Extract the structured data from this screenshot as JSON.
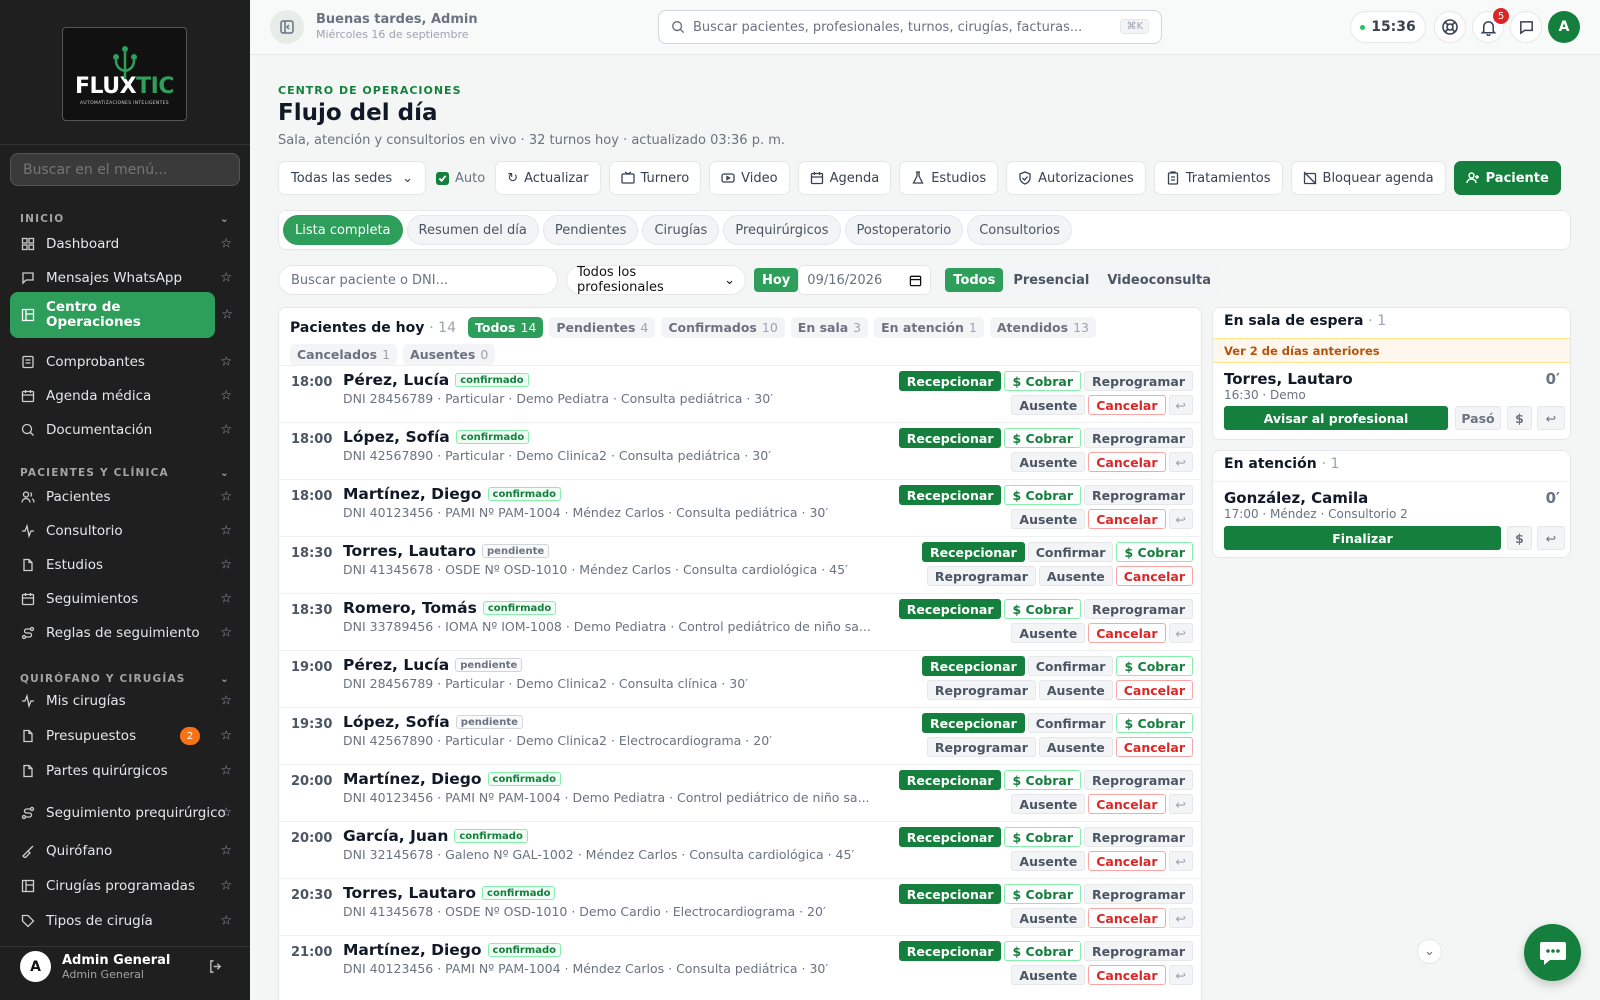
{
  "sidebar": {
    "logo_text_a": "FLUX",
    "logo_text_b": "TIC",
    "logo_sub": "AUTOMATIZACIONES INTELIGENTES",
    "search_placeholder": "Buscar en el menú...",
    "sections": [
      {
        "title": "INICIO"
      },
      {
        "title": "PACIENTES Y CLÍNICA"
      },
      {
        "title": "QUIRÓFANO Y CIRUGÍAS"
      }
    ],
    "items": [
      {
        "label": "Dashboard",
        "icon": "grid-icon"
      },
      {
        "label": "Mensajes WhatsApp",
        "icon": "chat-icon"
      },
      {
        "label": "Centro de Operaciones",
        "icon": "layout-icon",
        "active": true
      },
      {
        "label": "Comprobantes",
        "icon": "receipt-icon"
      },
      {
        "label": "Agenda médica",
        "icon": "calendar-icon"
      },
      {
        "label": "Documentación",
        "icon": "search-doc-icon"
      },
      {
        "label": "Pacientes",
        "icon": "users-icon"
      },
      {
        "label": "Consultorio",
        "icon": "activity-icon"
      },
      {
        "label": "Estudios",
        "icon": "file-icon"
      },
      {
        "label": "Seguimientos",
        "icon": "calendar-icon"
      },
      {
        "label": "Reglas de seguimiento",
        "icon": "route-icon"
      },
      {
        "label": "Mis cirugías",
        "icon": "activity-icon"
      },
      {
        "label": "Presupuestos",
        "icon": "file-icon",
        "badge": "2"
      },
      {
        "label": "Partes quirúrgicos",
        "icon": "file-icon"
      },
      {
        "label": "Seguimiento prequirúrgico",
        "icon": "route-icon"
      },
      {
        "label": "Quirófano",
        "icon": "scalpel-icon"
      },
      {
        "label": "Cirugías programadas",
        "icon": "layout-icon"
      },
      {
        "label": "Tipos de cirugía",
        "icon": "tag-icon"
      }
    ],
    "user": {
      "initial": "A",
      "name": "Admin General",
      "role": "Admin General"
    }
  },
  "topbar": {
    "greeting": "Buenas tardes, Admin",
    "date": "Miércoles 16 de septiembre",
    "search_placeholder": "Buscar pacientes, profesionales, turnos, cirugías, facturas...",
    "shortcut": "⌘K",
    "clock": "15:36",
    "notifications": "5",
    "avatar": "A"
  },
  "header": {
    "eyebrow": "CENTRO DE OPERACIONES",
    "title": "Flujo del día",
    "subtitle": "Sala, atención y consultorios en vivo · 32 turnos hoy · actualizado 03:36 p. m."
  },
  "toolbar": {
    "sede": "Todas las sedes",
    "auto": "Auto",
    "buttons": [
      "Actualizar",
      "Turnero",
      "Video",
      "Agenda",
      "Estudios",
      "Autorizaciones",
      "Tratamientos",
      "Bloquear agenda"
    ],
    "primary": "Paciente"
  },
  "tabs": [
    "Lista completa",
    "Resumen del día",
    "Pendientes",
    "Cirugías",
    "Prequirúrgicos",
    "Postoperatorio",
    "Consultorios"
  ],
  "filters": {
    "search_placeholder": "Buscar paciente o DNI...",
    "professional": "Todos los profesionales",
    "today": "Hoy",
    "date": "09/16/2026",
    "modes": [
      "Todos",
      "Presencial",
      "Videoconsulta"
    ]
  },
  "list": {
    "title": "Pacientes de hoy",
    "count": "14",
    "status_filters": [
      {
        "label": "Todos",
        "count": "14"
      },
      {
        "label": "Pendientes",
        "count": "4"
      },
      {
        "label": "Confirmados",
        "count": "10"
      },
      {
        "label": "En sala",
        "count": "3"
      },
      {
        "label": "En atención",
        "count": "1"
      },
      {
        "label": "Atendidos",
        "count": "13"
      },
      {
        "label": "Cancelados",
        "count": "1"
      },
      {
        "label": "Ausentes",
        "count": "0"
      }
    ],
    "actions": {
      "receive": "Recepcionar",
      "charge": "$ Cobrar",
      "reschedule": "Reprogramar",
      "absent": "Ausente",
      "cancel": "Cancelar",
      "confirm": "Confirmar",
      "undo": "↩"
    },
    "rows": [
      {
        "time": "18:00",
        "name": "Pérez, Lucía",
        "status": "confirmado",
        "detail": "DNI 28456789 · Particular · Demo Pediatra · Consulta pediátrica · 30′"
      },
      {
        "time": "18:00",
        "name": "López, Sofía",
        "status": "confirmado",
        "detail": "DNI 42567890 · Particular · Demo Clinica2 · Consulta pediátrica · 30′"
      },
      {
        "time": "18:00",
        "name": "Martínez, Diego",
        "status": "confirmado",
        "detail": "DNI 40123456 · PAMI Nº PAM-1004 · Méndez Carlos · Consulta pediátrica · 30′"
      },
      {
        "time": "18:30",
        "name": "Torres, Lautaro",
        "status": "pendiente",
        "detail": "DNI 41345678 · OSDE Nº OSD-1010 · Méndez Carlos · Consulta cardiológica · 45′"
      },
      {
        "time": "18:30",
        "name": "Romero, Tomás",
        "status": "confirmado",
        "detail": "DNI 33789456 · IOMA Nº IOM-1008 · Demo Pediatra · Control pediátrico de niño sa..."
      },
      {
        "time": "19:00",
        "name": "Pérez, Lucía",
        "status": "pendiente",
        "detail": "DNI 28456789 · Particular · Demo Clinica2 · Consulta clínica · 30′"
      },
      {
        "time": "19:30",
        "name": "López, Sofía",
        "status": "pendiente",
        "detail": "DNI 42567890 · Particular · Demo Clinica2 · Electrocardiograma · 20′"
      },
      {
        "time": "20:00",
        "name": "Martínez, Diego",
        "status": "confirmado",
        "detail": "DNI 40123456 · PAMI Nº PAM-1004 · Demo Pediatra · Control pediátrico de niño sa..."
      },
      {
        "time": "20:00",
        "name": "García, Juan",
        "status": "confirmado",
        "detail": "DNI 32145678 · Galeno Nº GAL-1002 · Méndez Carlos · Consulta cardiológica · 45′"
      },
      {
        "time": "20:30",
        "name": "Torres, Lautaro",
        "status": "confirmado",
        "detail": "DNI 41345678 · OSDE Nº OSD-1010 · Demo Cardio · Electrocardiograma · 20′"
      },
      {
        "time": "21:00",
        "name": "Martínez, Diego",
        "status": "confirmado",
        "detail": "DNI 40123456 · PAMI Nº PAM-1004 · Méndez Carlos · Consulta pediátrica · 30′"
      }
    ]
  },
  "waiting": {
    "title": "En sala de espera",
    "count": "1",
    "warning": "Ver 2 de días anteriores",
    "patient": "Torres, Lautaro",
    "detail": "16:30 · Demo",
    "minutes": "0′",
    "notify": "Avisar al profesional",
    "passed": "Pasó",
    "charge": "$",
    "undo": "↩"
  },
  "attention": {
    "title": "En atención",
    "count": "1",
    "patient": "González, Camila",
    "detail": "17:00 · Méndez · Consultorio 2",
    "minutes": "0′",
    "finish": "Finalizar",
    "charge": "$",
    "undo": "↩"
  },
  "colors": {
    "brand": "#15803d",
    "accent": "#2e9e5b",
    "danger": "#dc2626",
    "warning": "#b45309"
  }
}
